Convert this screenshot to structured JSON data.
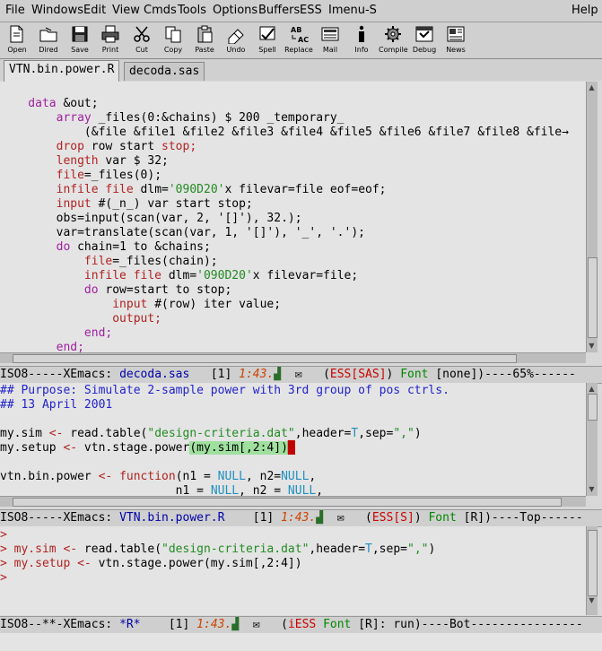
{
  "menubar": {
    "file": "File",
    "windows": "Windows",
    "edit": "Edit",
    "view": "View",
    "cmds": "Cmds",
    "tools": "Tools",
    "options": "Options",
    "buffers": "Buffers",
    "ess": "ESS",
    "imenu": "Imenu-S",
    "help": "Help"
  },
  "toolbar": {
    "open": "Open",
    "dired": "Dired",
    "save": "Save",
    "print": "Print",
    "cut": "Cut",
    "copy": "Copy",
    "paste": "Paste",
    "undo": "Undo",
    "spell": "Spell",
    "replace": "Replace",
    "mail": "Mail",
    "info": "Info",
    "compile": "Compile",
    "debug": "Debug",
    "news": "News"
  },
  "tabs": [
    "VTN.bin.power.R",
    "decoda.sas"
  ],
  "sas_pane": {
    "lines": [
      "    data &out;",
      "        array _files(0:&chains) $ 200 _temporary_",
      "            (&file &file1 &file2 &file3 &file4 &file5 &file6 &file7 &file8 &file",
      "        drop row start stop;",
      "        length var $ 32;",
      "        file=_files(0);",
      "        infile file dlm='090D20'x filevar=file eof=eof;",
      "        input #(_n_) var start stop;",
      "        obs=input(scan(var, 2, '[]'), 32.);",
      "        var=translate(scan(var, 1, '[]'), '_', '.');",
      "        do chain=1 to &chains;",
      "            file=_files(chain);",
      "            infile file dlm='090D20'x filevar=file;",
      "            do row=start to stop;",
      "                input #(row) iter value;",
      "                output;",
      "            end;",
      "        end;"
    ]
  },
  "modeline1": {
    "prefix": "ISO8-----XEmacs: ",
    "buffer": "decoda.sas",
    "num": "   [1] ",
    "time": "1:43.",
    "mode_open": "   (",
    "ess": "ESS[SAS]",
    "font": "Font",
    "rest": " [none])----65%------"
  },
  "r_pane": {
    "comment1": "## Purpose: Simulate 2-sample power with 3rd group of pos ctrls.",
    "comment2": "## 13 April 2001",
    "line4a": "my.sim ",
    "line4b": "<-",
    "line4c": " read.table(",
    "line4d": "\"design-criteria.dat\"",
    "line4e": ",header=",
    "line4f": "T",
    "line4g": ",sep=",
    "line4h": "\",\"",
    "line4i": ")",
    "line5a": "my.setup ",
    "line5b": "<-",
    "line5c": " vtn.stage.power",
    "line5d": "(my.sim[,2:4])",
    "line7a": "vtn.bin.power ",
    "line7b": "<-",
    "line7c": " ",
    "line7d": "function",
    "line7e": "(n1 = ",
    "line7f": "NULL",
    "line7g": ", n2=",
    "line7h": "NULL",
    "line7i": ",",
    "line8a": "                         n1 = ",
    "line8b": "NULL",
    "line8c": ", n2 = ",
    "line8d": "NULL",
    "line8e": ","
  },
  "modeline2": {
    "prefix": "ISO8-----XEmacs: ",
    "buffer": "VTN.bin.power.R",
    "num": "    [1] ",
    "time": "1:43.",
    "mode_open": "   (",
    "ess": "ESS[S]",
    "font": "Font",
    "rest": " [R])----Top------"
  },
  "iess_pane": {
    "l1": ">",
    "l2a": "> my.sim ",
    "l2b": "<-",
    "l2c": " read.table(",
    "l2d": "\"design-criteria.dat\"",
    "l2e": ",header=",
    "l2f": "T",
    "l2g": ",sep=",
    "l2h": "\",\"",
    "l2i": ")",
    "l3a": "> my.setup ",
    "l3b": "<-",
    "l3c": " vtn.stage.power(my.sim[,2:4])",
    "l4": ">"
  },
  "modeline3": {
    "prefix": "ISO8--**-XEmacs: ",
    "buffer": "*R*",
    "num": "    [1] ",
    "time": "1:43.",
    "mode_open": "   (",
    "ess": "iESS",
    "font": "Font",
    "rest": " [R]: run)----Bot----------------"
  }
}
